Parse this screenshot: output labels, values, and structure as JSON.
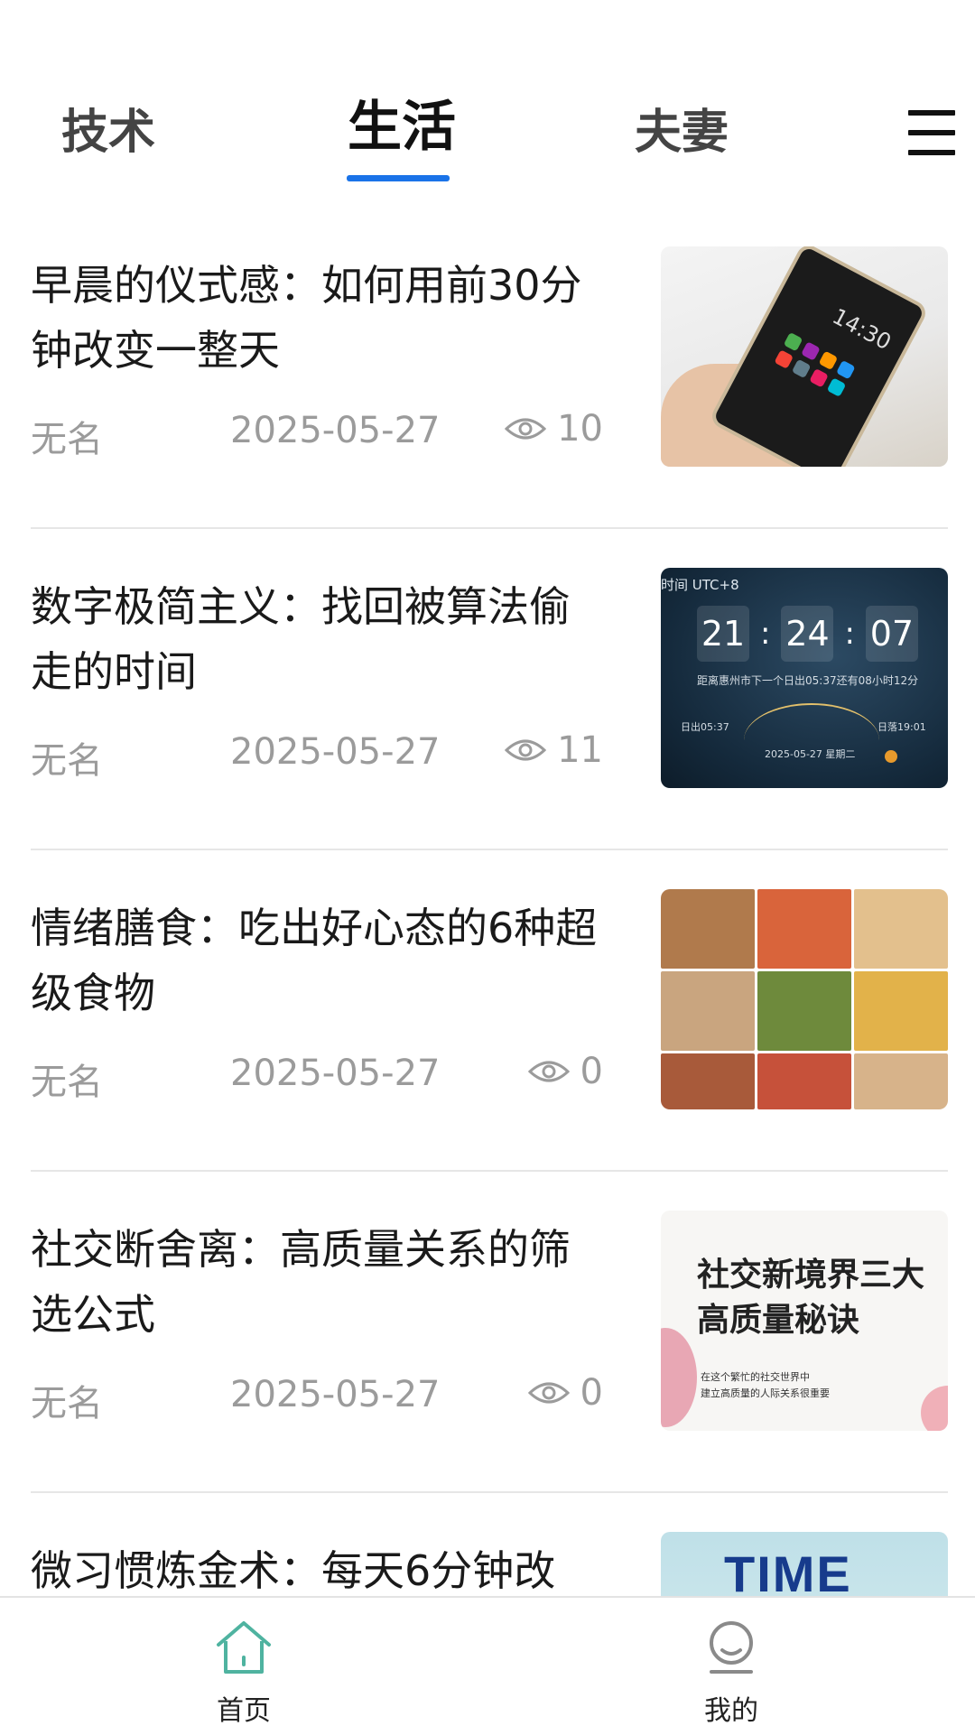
{
  "tabs": [
    {
      "label": "技术",
      "active": false
    },
    {
      "label": "生活",
      "active": true
    },
    {
      "label": "夫妻",
      "active": false
    }
  ],
  "accent_color": "#1a73e8",
  "menu_icon": "hamburger-menu-icon",
  "articles": [
    {
      "title": "早晨的仪式感：如何用前30分钟改变一整天",
      "author": "无名",
      "date": "2025-05-27",
      "views": "10"
    },
    {
      "title": "数字极简主义：找回被算法偷走的时间",
      "author": "无名",
      "date": "2025-05-27",
      "views": "11",
      "thumb_text": {
        "utc": "时间 UTC+8",
        "h": "21",
        "m": "24",
        "s": "07",
        "sub": "距离惠州市下一个日出05:37还有08小时12分",
        "rise": "日出05:37",
        "set": "日落19:01",
        "dt": "2025-05-27  星期二"
      }
    },
    {
      "title": "情绪膳食：吃出好心态的6种超级食物",
      "author": "无名",
      "date": "2025-05-27",
      "views": "0"
    },
    {
      "title": "社交断舍离：高质量关系的筛选公式",
      "author": "无名",
      "date": "2025-05-27",
      "views": "0",
      "thumb_text": {
        "big": "社交新境界三大高质量秘诀",
        "small1": "在这个繁忙的社交世界中",
        "small2": "建立高质量的人际关系很重要"
      }
    },
    {
      "title": "微习惯炼金术：每天6分钟改",
      "author": "",
      "date": "",
      "views": "",
      "thumb_text": {
        "logo": "TIME"
      }
    }
  ],
  "bottom_nav": [
    {
      "label": "首页",
      "icon": "home-icon",
      "active": true
    },
    {
      "label": "我的",
      "icon": "profile-icon",
      "active": false
    }
  ]
}
